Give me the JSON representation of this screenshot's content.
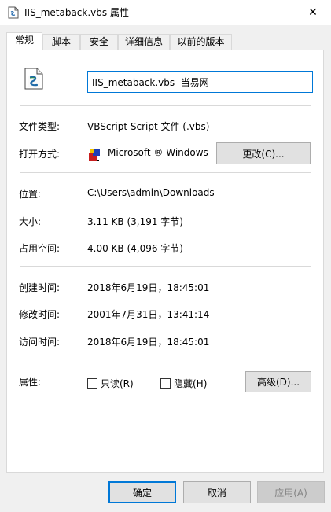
{
  "window": {
    "title": "IIS_metaback.vbs 属性",
    "close_glyph": "✕"
  },
  "tabs": [
    {
      "label": "常规"
    },
    {
      "label": "脚本"
    },
    {
      "label": "安全"
    },
    {
      "label": "详细信息"
    },
    {
      "label": "以前的版本"
    }
  ],
  "general": {
    "file_name": "IIS_metaback.vbs  当易网",
    "file_type_label": "文件类型:",
    "file_type_value": "VBScript Script 文件 (.vbs)",
    "opens_with_label": "打开方式:",
    "opens_with_value": "Microsoft ® Windows",
    "change_button": "更改(C)...",
    "location_label": "位置:",
    "location_value": "C:\\Users\\admin\\Downloads",
    "size_label": "大小:",
    "size_value": "3.11 KB (3,191 字节)",
    "size_on_disk_label": "占用空间:",
    "size_on_disk_value": "4.00 KB (4,096 字节)",
    "created_label": "创建时间:",
    "created_value": "2018年6月19日，18:45:01",
    "modified_label": "修改时间:",
    "modified_value": "2001年7月31日，13:41:14",
    "accessed_label": "访问时间:",
    "accessed_value": "2018年6月19日，18:45:01",
    "attributes_label": "属性:",
    "readonly_label": "只读(R)",
    "hidden_label": "隐藏(H)",
    "advanced_button": "高级(D)..."
  },
  "footer": {
    "ok": "确定",
    "cancel": "取消",
    "apply": "应用(A)"
  },
  "colors": {
    "accent": "#0078d7",
    "window_bg": "#f0f0f0",
    "panel_bg": "#ffffff"
  }
}
